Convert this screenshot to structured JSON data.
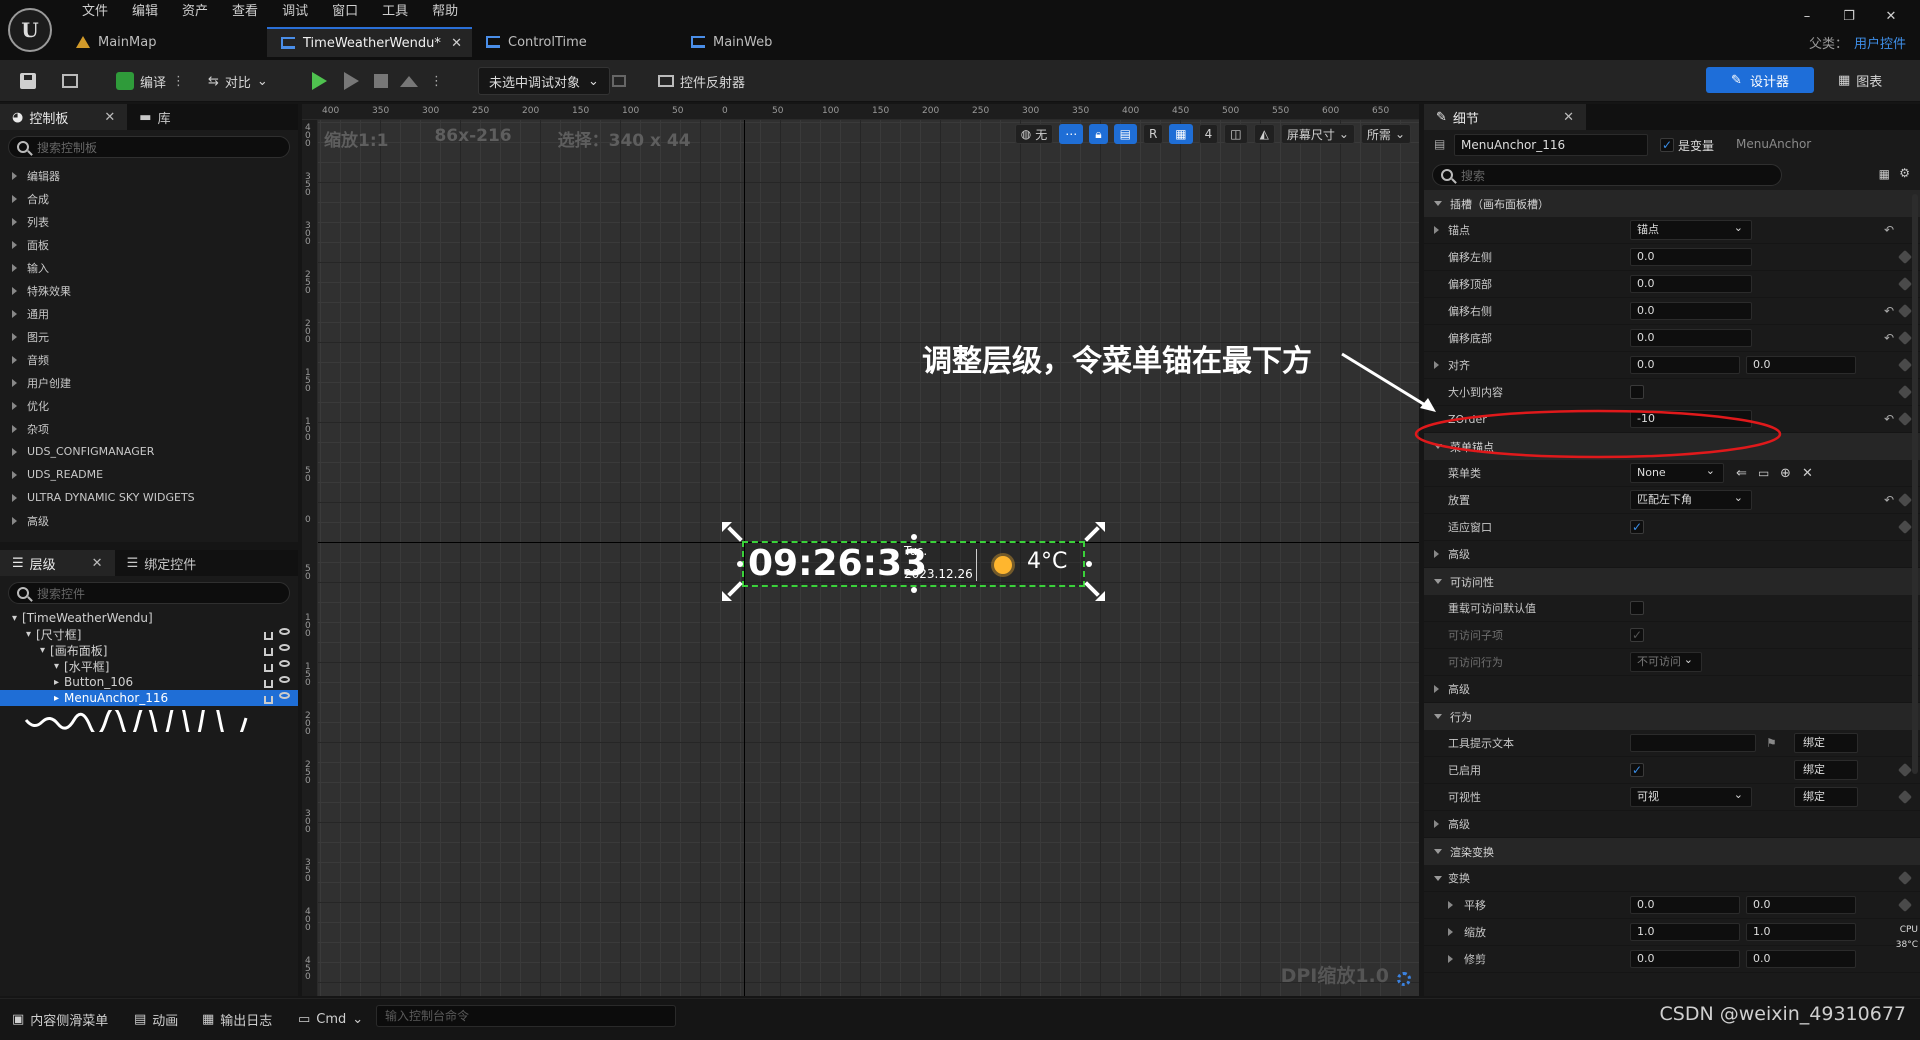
{
  "menu": [
    "文件",
    "编辑",
    "资产",
    "查看",
    "调试",
    "窗口",
    "工具",
    "帮助"
  ],
  "logo_text": "U",
  "window_controls": [
    "–",
    "❐",
    "✕"
  ],
  "tabs": [
    {
      "label": "MainMap",
      "active": false
    },
    {
      "label": "TimeWeatherWendu*",
      "active": true
    },
    {
      "label": "ControlTime",
      "active": false
    },
    {
      "label": "MainWeb",
      "active": false
    }
  ],
  "tab_close": "✕",
  "parent_class": {
    "label": "父类：",
    "value": "用户控件"
  },
  "toolbar": {
    "compile": "编译",
    "diff": "对比",
    "debug_target": "未选中调试对象",
    "widget_reflector": "控件反射器",
    "designer": "设计器",
    "graph": "图表"
  },
  "palette": {
    "tab_palette": "控制板",
    "tab_library": "库",
    "close": "✕",
    "search_placeholder": "搜索控制板",
    "categories": [
      "编辑器",
      "合成",
      "列表",
      "面板",
      "输入",
      "特殊效果",
      "通用",
      "图元",
      "音频",
      "用户创建",
      "优化",
      "杂项",
      "UDS_CONFIGMANAGER",
      "UDS_README",
      "ULTRA DYNAMIC SKY WIDGETS",
      "高级"
    ]
  },
  "hierarchy": {
    "tab_hierarchy": "层级",
    "tab_bind": "绑定控件",
    "close": "✕",
    "search_placeholder": "搜索控件",
    "rows": [
      {
        "label": "[TimeWeatherWendu]",
        "indent": 0
      },
      {
        "label": "[尺寸框]",
        "indent": 1
      },
      {
        "label": "[画布面板]",
        "indent": 2
      },
      {
        "label": "[水平框]",
        "indent": 3
      },
      {
        "label": "Button_106",
        "indent": 3
      },
      {
        "label": "MenuAnchor_116",
        "indent": 3
      }
    ]
  },
  "viewport": {
    "zoom": "缩放1:1",
    "size": "86x-216",
    "selection": "选择：340 x 44",
    "tool_none": "无",
    "tool_r": "R",
    "grid_value": "4",
    "screen_size": "屏幕尺寸",
    "fill": "所需",
    "dpi": "DPI缩放1.0",
    "ruler_top": [
      "400",
      "350",
      "300",
      "250",
      "200",
      "150",
      "100",
      "50",
      "0",
      "50",
      "100",
      "150",
      "200",
      "250",
      "300",
      "350",
      "400",
      "450",
      "500",
      "550",
      "600",
      "650"
    ],
    "ruler_left": [
      "400",
      "350",
      "300",
      "250",
      "200",
      "150",
      "100",
      "50",
      "0",
      "50",
      "100",
      "150",
      "200",
      "250",
      "300",
      "350",
      "400",
      "450"
    ]
  },
  "widget": {
    "time": "09:26:33",
    "day": "Tus.",
    "date": "2023.12.26",
    "temp": "4°C"
  },
  "annotation": "调整层级，令菜单锚在最下方",
  "details": {
    "tab": "细节",
    "close": "✕",
    "name": "MenuAnchor_116",
    "is_variable_label": "是变量",
    "class_label": "MenuAnchor",
    "search_placeholder": "搜索",
    "slot_section": "插槽（画布面板槽）",
    "anchor_label": "锚点",
    "anchor_value": "锚点",
    "offset_left": "偏移左侧",
    "offset_left_val": "0.0",
    "offset_top": "偏移顶部",
    "offset_top_val": "0.0",
    "offset_right": "偏移右侧",
    "offset_right_val": "0.0",
    "offset_bottom": "偏移底部",
    "offset_bottom_val": "0.0",
    "alignment": "对齐",
    "alignment_x": "0.0",
    "alignment_y": "0.0",
    "size_to_content": "大小到内容",
    "zorder": "ZOrder",
    "zorder_val": "-10",
    "menu_anchor_section": "菜单锚点",
    "menu_class": "菜单类",
    "menu_class_val": "None",
    "placement": "放置",
    "placement_val": "匹配左下角",
    "fit_in_window": "适应窗口",
    "advanced": "高级",
    "accessibility_section": "可访问性",
    "override_access": "重载可访问默认值",
    "access_children": "可访问子项",
    "access_behavior": "可访问行为",
    "access_behavior_val": "不可访问",
    "behavior_section": "行为",
    "tooltip": "工具提示文本",
    "enabled": "已启用",
    "visibility": "可视性",
    "visibility_val": "可视",
    "bind": "绑定",
    "render_section": "渲染变换",
    "transform": "变换",
    "translation": "平移",
    "translation_x": "0.0",
    "translation_y": "0.0",
    "scale": "缩放",
    "scale_x": "1.0",
    "scale_y": "1.0",
    "shear": "修剪",
    "shear_x": "0.0",
    "shear_y": "0.0",
    "cpu_label": "CPU",
    "cpu_temp": "38°C"
  },
  "statusbar": {
    "content_drawer": "内容侧滑菜单",
    "animation": "动画",
    "output_log": "输出日志",
    "cmd": "Cmd",
    "console_placeholder": "输入控制台命令",
    "watermark": "CSDN @weixin_49310677"
  },
  "accent_colors": {
    "selection": "#1f6ed6",
    "widget_border": "#3ad13a",
    "annotation_ellipse": "#e0191b"
  }
}
